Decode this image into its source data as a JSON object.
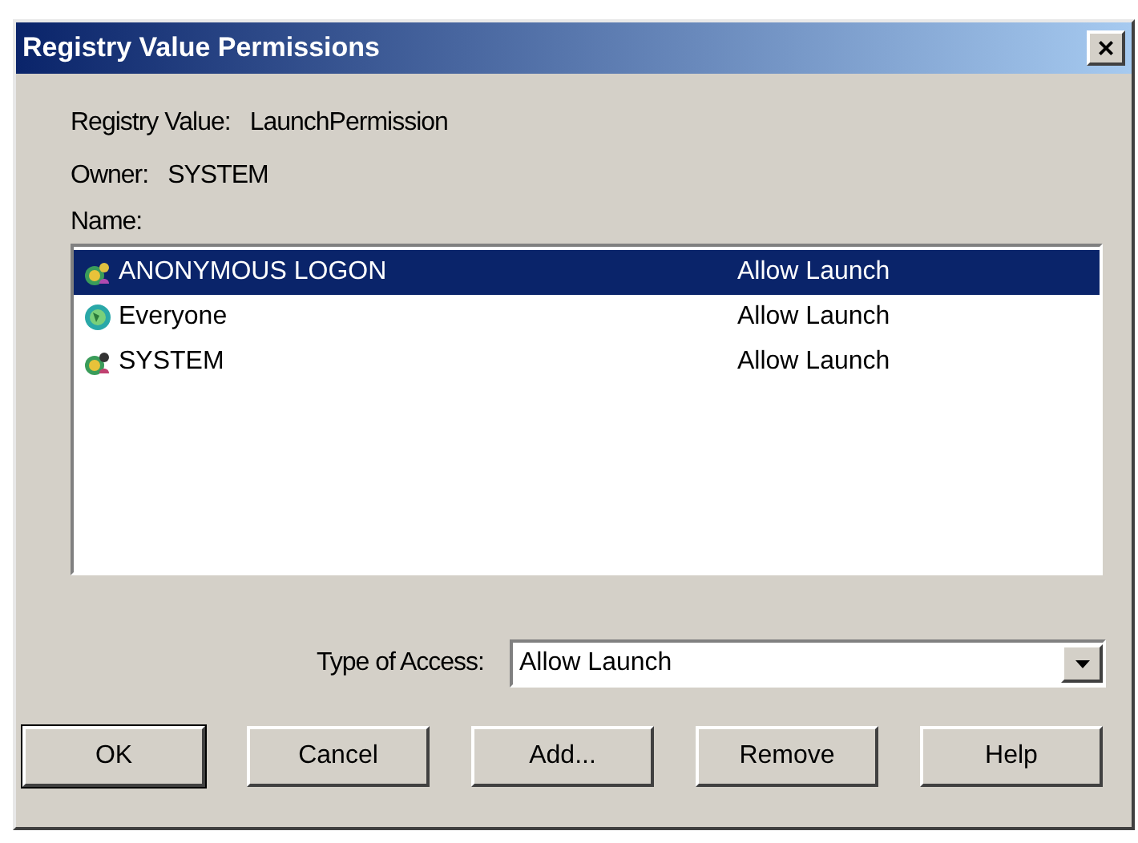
{
  "window": {
    "title": "Registry Value Permissions",
    "close": "×"
  },
  "fields": [
    {
      "label": "Registry Value:",
      "value": "LaunchPermission"
    },
    {
      "label": "Owner:",
      "value": "SYSTEM"
    }
  ],
  "list_label": "Name:",
  "entries": [
    {
      "name": "ANONYMOUS LOGON",
      "access": "Allow Launch",
      "selected": true,
      "kind": "anonymous"
    },
    {
      "name": "Everyone",
      "access": "Allow Launch",
      "selected": false,
      "kind": "globe"
    },
    {
      "name": "SYSTEM",
      "access": "Allow Launch",
      "selected": false,
      "kind": "system"
    }
  ],
  "type_of_access": {
    "label": "Type of Access:",
    "value": "Allow Launch"
  },
  "buttons": [
    {
      "label": "OK",
      "default": true
    },
    {
      "label": "Cancel",
      "default": false
    },
    {
      "label": "Add...",
      "default": false
    },
    {
      "label": "Remove",
      "default": false
    },
    {
      "label": "Help",
      "default": false
    }
  ]
}
